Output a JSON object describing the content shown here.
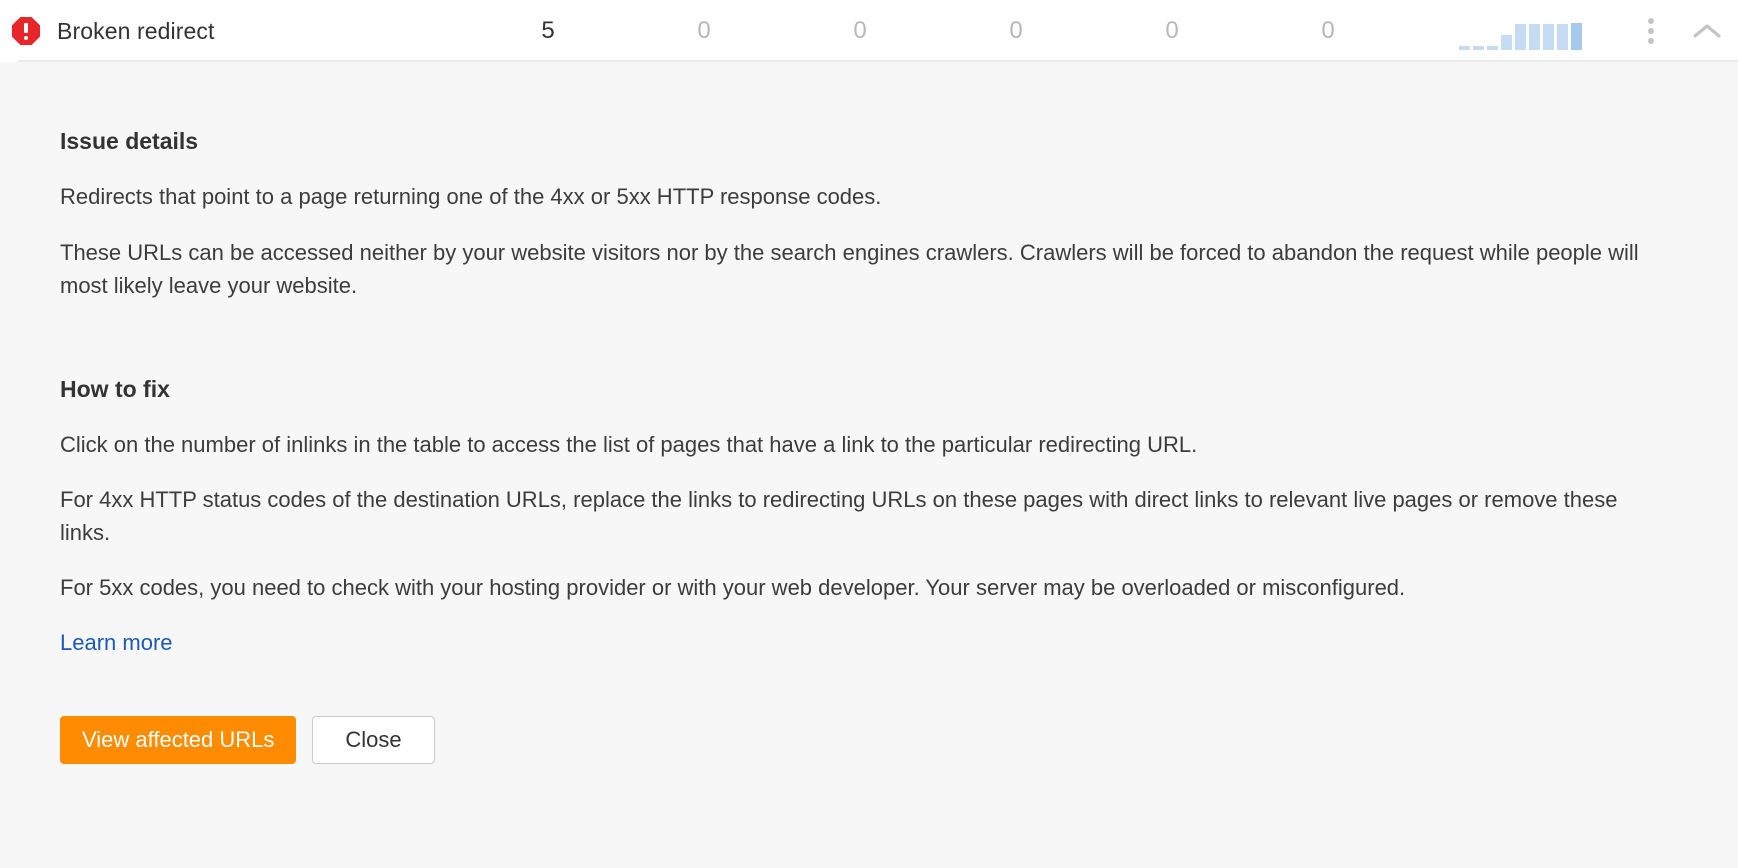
{
  "issue_row": {
    "status_icon": "error-octagon-icon",
    "title": "Broken redirect",
    "metrics": [
      {
        "value": "5",
        "highlight": true
      },
      {
        "value": "0",
        "highlight": false
      },
      {
        "value": "0",
        "highlight": false
      },
      {
        "value": "0",
        "highlight": false
      },
      {
        "value": "0",
        "highlight": false
      },
      {
        "value": "0",
        "highlight": false
      }
    ],
    "sparkline": {
      "bars": [
        4,
        4,
        4,
        15,
        26,
        26,
        26,
        26,
        27
      ],
      "color": "#c6dcf5",
      "last_color": "#a5c8ee"
    },
    "menu_icon": "more-vertical-icon",
    "collapse_icon": "chevron-up-icon"
  },
  "detail": {
    "issue_details_heading": "Issue details",
    "issue_details_paragraphs": [
      "Redirects that point to a page returning one of the 4xx or 5xx HTTP response codes.",
      "These URLs can be accessed neither by your website visitors nor by the search engines crawlers. Crawlers will be forced to abandon the request while people will most likely leave your website."
    ],
    "how_to_fix_heading": "How to fix",
    "how_to_fix_paragraphs": [
      "Click on the number of inlinks in the table to access the list of pages that have a link to the particular redirecting URL.",
      "For 4xx HTTP status codes of the destination URLs, replace the links to redirecting URLs on these pages with direct links to relevant live pages or remove these links.",
      "For 5xx codes, you need to check with your hosting provider or with your web developer. Your server may be overloaded or misconfigured."
    ],
    "learn_more_label": "Learn more",
    "primary_button_label": "View affected URLs",
    "secondary_button_label": "Close",
    "colors": {
      "primary_button": "#ff8c00",
      "link": "#1a5bb5",
      "status": "#e8262a",
      "panel_bg": "#f7f7f7"
    }
  }
}
